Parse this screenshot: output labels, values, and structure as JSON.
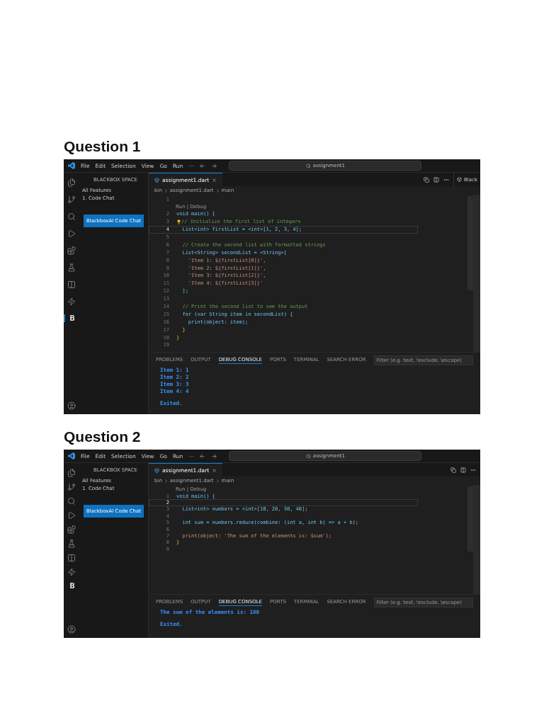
{
  "questions": [
    {
      "heading": "Question 1",
      "window": {
        "menu": [
          "File",
          "Edit",
          "Selection",
          "View",
          "Go",
          "Run",
          "···"
        ],
        "search": "assignment1",
        "activity_label": {
          "text": "B",
          "selected": true
        },
        "sidebar": {
          "title": "BLACKBOX SPACE",
          "items": [
            "All Features",
            "1. Code Chat"
          ],
          "button": "BlackboxAI Code Chat"
        },
        "tab": "assignment1.dart",
        "side_tab": "Black",
        "breadcrumbs": [
          "bin",
          "assignment1.dart",
          "main"
        ],
        "code": [
          {
            "number": "1",
            "current": false,
            "lightbulb": false
          },
          {
            "number": "2",
            "codelens": "Run | Debug",
            "text": "void main() {",
            "kind": "code",
            "current": false,
            "lightbulb": false
          },
          {
            "number": "3",
            "text": "// Initialize the first list of integers",
            "kind": "comment",
            "current": false,
            "lightbulb": true
          },
          {
            "number": "4",
            "text": "  List<int> firstList = <int>[1, 2, 3, 4];",
            "kind": "code",
            "current": true,
            "lightbulb": false
          },
          {
            "number": "5",
            "current": false,
            "lightbulb": false
          },
          {
            "number": "6",
            "text": "  // Create the second list with formatted strings",
            "kind": "comment",
            "current": false,
            "lightbulb": false
          },
          {
            "number": "7",
            "text": "  List<String> secondList = <String>[",
            "kind": "code",
            "current": false,
            "lightbulb": false
          },
          {
            "number": "8",
            "text": "    'Item 1: ${firstList[0]}',",
            "kind": "string",
            "current": false,
            "lightbulb": false
          },
          {
            "number": "9",
            "text": "    'Item 2: ${firstList[1]}',",
            "kind": "string",
            "current": false,
            "lightbulb": false
          },
          {
            "number": "10",
            "text": "    'Item 3: ${firstList[2]}',",
            "kind": "string",
            "current": false,
            "lightbulb": false
          },
          {
            "number": "11",
            "text": "    'Item 4: ${firstList[3]}'",
            "kind": "string",
            "current": false,
            "lightbulb": false
          },
          {
            "number": "12",
            "text": "  ];",
            "kind": "code",
            "current": false,
            "lightbulb": false
          },
          {
            "number": "13",
            "current": false,
            "lightbulb": false
          },
          {
            "number": "14",
            "text": "  // Print the second list to see the output",
            "kind": "comment",
            "current": false,
            "lightbulb": false
          },
          {
            "number": "15",
            "text": "  for (var String item in secondList) {",
            "kind": "code",
            "current": false,
            "lightbulb": false
          },
          {
            "number": "16",
            "text": "    print(object: item);",
            "kind": "code",
            "current": false,
            "lightbulb": false
          },
          {
            "number": "17",
            "text": "  }",
            "kind": "brace",
            "current": false,
            "lightbulb": false
          },
          {
            "number": "18",
            "text": "}",
            "kind": "brace",
            "current": false,
            "lightbulb": false
          },
          {
            "number": "19",
            "current": false,
            "lightbulb": false
          }
        ],
        "panel": {
          "tabs": [
            {
              "label": "PROBLEMS",
              "selected": false
            },
            {
              "label": "OUTPUT",
              "selected": false
            },
            {
              "label": "DEBUG CONSOLE",
              "selected": true
            },
            {
              "label": "PORTS",
              "selected": false
            },
            {
              "label": "TERMINAL",
              "selected": false
            },
            {
              "label": "SEARCH ERROR",
              "selected": false
            }
          ],
          "filter_placeholder": "Filter (e.g. text, !exclude, \\escape)",
          "output": [
            {
              "text": "Item 1: 1",
              "kind": "output"
            },
            {
              "text": "Item 2: 2",
              "kind": "output"
            },
            {
              "text": "Item 3: 3",
              "kind": "output"
            },
            {
              "text": "Item 4: 4",
              "kind": "output"
            },
            {
              "text": "Exited.",
              "kind": "status"
            }
          ]
        }
      }
    },
    {
      "heading": "Question 2",
      "window": {
        "menu": [
          "File",
          "Edit",
          "Selection",
          "View",
          "Go",
          "Run",
          "···"
        ],
        "search": "assignment1",
        "activity_label": {
          "text": "B",
          "selected": false
        },
        "sidebar": {
          "title": "BLACKBOX SPACE",
          "items": [
            "All Features",
            "1. Code Chat"
          ],
          "button": "BlackboxAI Code Chat"
        },
        "tab": "assignment1.dart",
        "breadcrumbs": [
          "bin",
          "assignment1.dart",
          "main"
        ],
        "code": [
          {
            "number": "1",
            "codelens": "Run | Debug",
            "text": "void main() {",
            "kind": "code",
            "current": false,
            "lightbulb": false
          },
          {
            "number": "2",
            "current": true,
            "lightbulb": false
          },
          {
            "number": "3",
            "text": "  List<int> numbers = <int>[10, 20, 30, 40];",
            "kind": "code",
            "current": false,
            "lightbulb": false
          },
          {
            "number": "4",
            "current": false,
            "lightbulb": false
          },
          {
            "number": "5",
            "text": "  int sum = numbers.reduce(combine: (int a, int b) => a + b);",
            "kind": "code",
            "current": false,
            "lightbulb": false
          },
          {
            "number": "6",
            "current": false,
            "lightbulb": false
          },
          {
            "number": "7",
            "text": "  print(object: 'The sum of the elements is: $sum');",
            "kind": "string",
            "current": false,
            "lightbulb": false
          },
          {
            "number": "8",
            "text": "}",
            "kind": "brace",
            "current": false,
            "lightbulb": false
          },
          {
            "number": "9",
            "current": false,
            "lightbulb": false
          }
        ],
        "panel": {
          "tabs": [
            {
              "label": "PROBLEMS",
              "selected": false
            },
            {
              "label": "OUTPUT",
              "selected": false
            },
            {
              "label": "DEBUG CONSOLE",
              "selected": true
            },
            {
              "label": "PORTS",
              "selected": false
            },
            {
              "label": "TERMINAL",
              "selected": false
            },
            {
              "label": "SEARCH ERROR",
              "selected": false
            }
          ],
          "filter_placeholder": "Filter (e.g. text, !exclude, \\escape)",
          "output": [
            {
              "text": "The sum of the elements is: 100",
              "kind": "output"
            },
            {
              "text": "Exited.",
              "kind": "status"
            }
          ]
        }
      }
    }
  ]
}
